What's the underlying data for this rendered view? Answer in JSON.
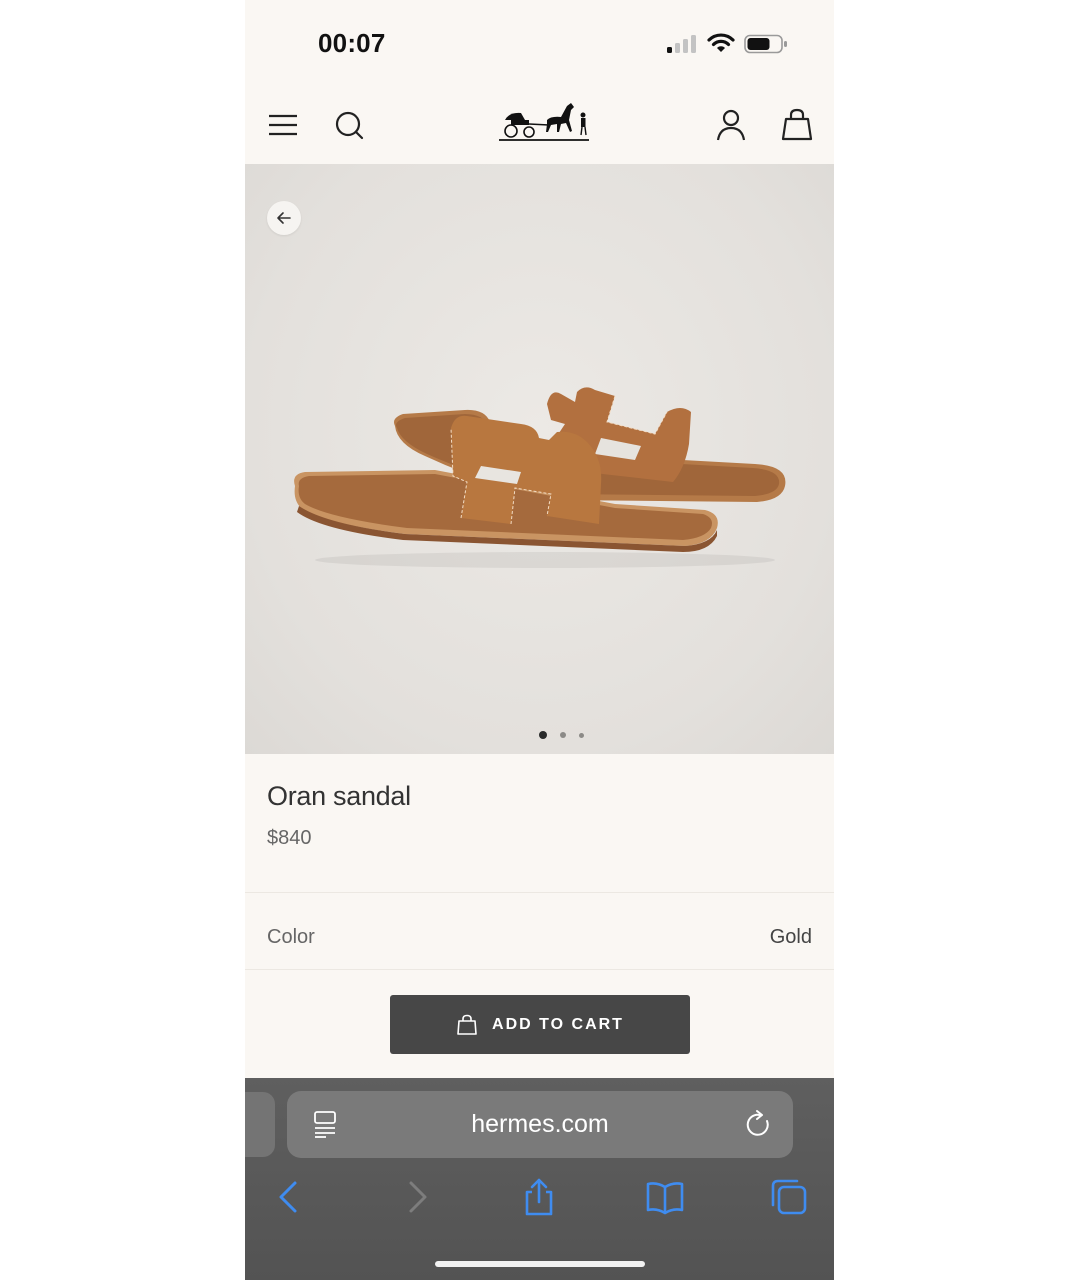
{
  "status_bar": {
    "time": "00:07",
    "icons": [
      "cellular-signal-icon",
      "wifi-icon",
      "battery-icon"
    ]
  },
  "header": {
    "icons": [
      "menu-icon",
      "search-icon",
      "hermes-carriage-logo",
      "account-icon",
      "shopping-bag-icon"
    ]
  },
  "gallery": {
    "slide_count": 3,
    "active_slide": 1,
    "image_subject": "tan leather flat sandals"
  },
  "product": {
    "name": "Oran sandal",
    "price": "$840",
    "color_label": "Color",
    "color_value": "Gold",
    "add_to_cart_label": "ADD TO CART"
  },
  "browser": {
    "url": "hermes.com",
    "toolbar_icons": [
      "back-icon",
      "forward-icon",
      "share-icon",
      "bookmarks-icon",
      "tabs-icon"
    ]
  },
  "colors": {
    "page_background": "#faf7f3",
    "button_dark": "#474747",
    "browser_accent": "#3f8cf0",
    "leather": "#a8683a"
  }
}
